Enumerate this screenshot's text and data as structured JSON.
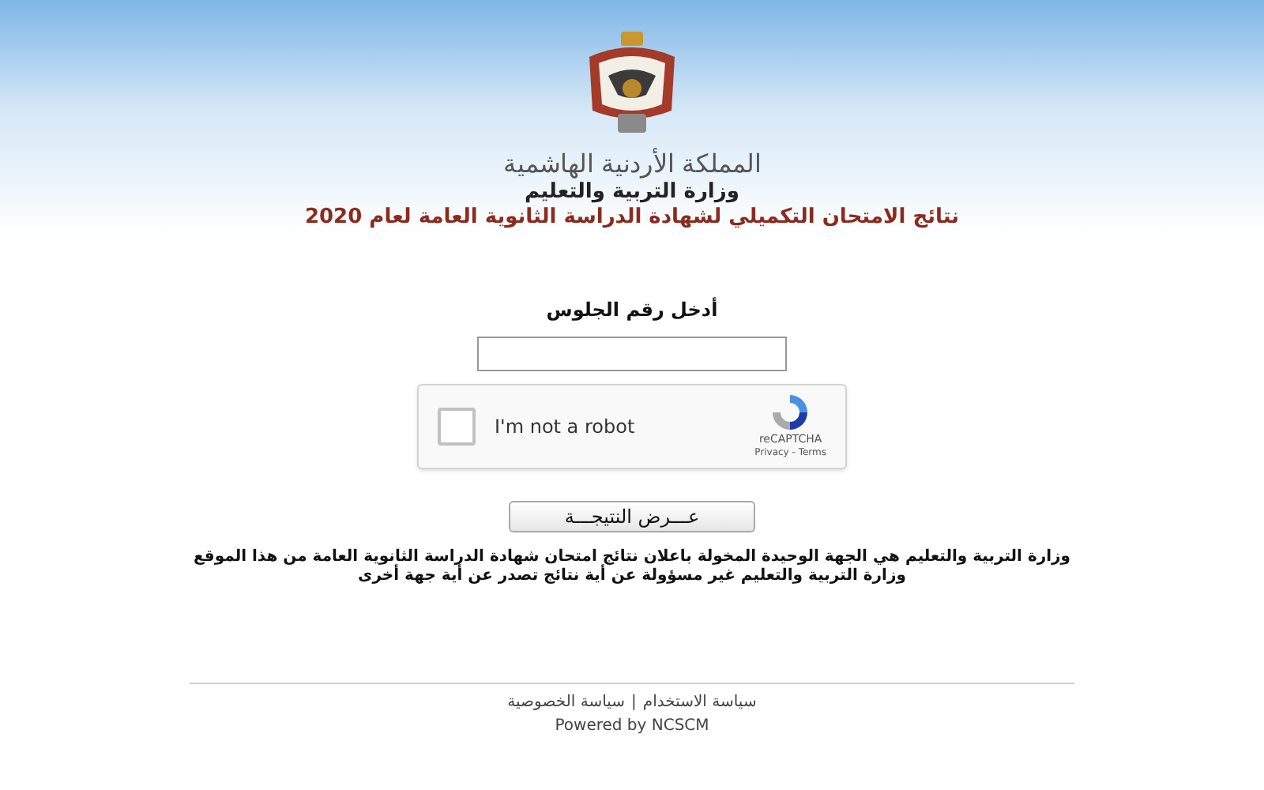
{
  "header": {
    "kingdom": "المملكة الأردنية الهاشمية",
    "ministry": "وزارة التربية والتعليم",
    "title": "نتائج الامتحان التكميلي لشهادة الدراسة الثانوية العامة لعام 2020"
  },
  "form": {
    "label": "أدخل رقم الجلوس",
    "captcha": {
      "checked": false,
      "label": "I'm not a robot",
      "brand": "reCAPTCHA",
      "links": "Privacy - Terms"
    },
    "button": "عـــرض النتيجـــة"
  },
  "notice": [
    "وزارة التربية والتعليم هي الجهة الوحيدة المخولة باعلان نتائج امتحان شهادة الدراسة الثانوية العامة من هذا الموقع",
    "وزارة التربية والتعليم غير مسؤولة عن أية نتائج تصدر عن أية جهة أخرى"
  ],
  "footer": {
    "links": [
      "سياسة الاستخدام",
      "سياسة الخصوصية"
    ],
    "separator": "|",
    "powered": "Powered by NCSCM"
  }
}
